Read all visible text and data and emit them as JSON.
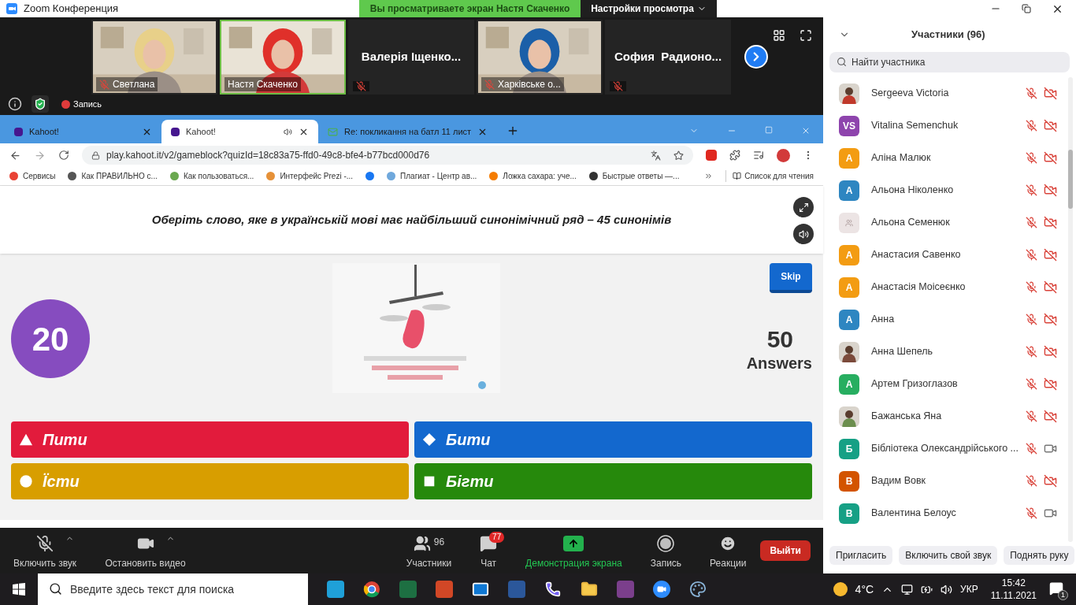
{
  "window": {
    "title": "Zoom Конференция"
  },
  "banner": {
    "text": "Вы просматриваете экран Настя Скаченко",
    "settings": "Настройки просмотра"
  },
  "videos": [
    {
      "kind": "video",
      "name": "Светлана",
      "muted": true,
      "selected": false
    },
    {
      "kind": "video",
      "name": "Настя Скаченко",
      "muted": false,
      "selected": true
    },
    {
      "kind": "name",
      "name": "Валерія Іщенко...",
      "muted": true,
      "selected": false
    },
    {
      "kind": "video",
      "name": "Харківське о...",
      "muted": true,
      "selected": false
    },
    {
      "kind": "name",
      "name": "София  Радионо...",
      "muted": true,
      "selected": false
    }
  ],
  "recording": "Запись",
  "browser": {
    "tabs": [
      {
        "title": "Kahoot!",
        "selected": false,
        "audio": false,
        "kind": "kahoot"
      },
      {
        "title": "Kahoot!",
        "selected": true,
        "audio": true,
        "kind": "kahoot"
      },
      {
        "title": "Re: покликання на батл 11 лист",
        "selected": false,
        "audio": false,
        "kind": "mail"
      }
    ],
    "url": "play.kahoot.it/v2/gameblock?quizId=18c83a75-ffd0-49c8-bfe4-b77bcd000d76",
    "bookmarks": [
      {
        "title": "Сервисы",
        "color": "#e94235"
      },
      {
        "title": "Как ПРАВИЛЬНО с...",
        "color": "#555555"
      },
      {
        "title": "Как пользоваться...",
        "color": "#6aa84f"
      },
      {
        "title": "Интерфейс Prezi -...",
        "color": "#e69138"
      },
      {
        "color": "#1877f2"
      },
      {
        "title": "Плагиат - Центр ав...",
        "color": "#6fa8dc"
      },
      {
        "title": "Ложка сахара: уче...",
        "color": "#f57c00"
      },
      {
        "title": "Быстрые ответы —...",
        "color": "#333333"
      }
    ],
    "reading_list": "Список для чтения"
  },
  "kahoot": {
    "question": "Оберіть слово, яке в українській мові має найбільший синонімічний ряд – 45 синонімів",
    "timer": "20",
    "skip": "Skip",
    "answers_count": "50",
    "answers_label": "Answers",
    "options": [
      {
        "kind": "triangle",
        "label": "Пити",
        "color": "#e21b3c"
      },
      {
        "kind": "diamond",
        "label": "Бити",
        "color": "#1368ce"
      },
      {
        "kind": "circle",
        "label": "Їсти",
        "color": "#d89e00"
      },
      {
        "kind": "square",
        "label": "Бігти",
        "color": "#26890c"
      }
    ]
  },
  "toolbar": {
    "items": [
      {
        "kind": "mic",
        "label": "Включить звук",
        "muted": true
      },
      {
        "kind": "video",
        "label": "Остановить видео"
      },
      {
        "kind": "participants",
        "label": "Участники",
        "count": "96"
      },
      {
        "kind": "chat",
        "label": "Чат",
        "badge": "77"
      },
      {
        "kind": "share",
        "label": "Демонстрация экрана",
        "active": true
      },
      {
        "kind": "record",
        "label": "Запись"
      },
      {
        "kind": "reactions",
        "label": "Реакции"
      }
    ],
    "leave": "Выйти"
  },
  "participants": {
    "title": "Участники (96)",
    "search_placeholder": "Найти участника",
    "people": [
      {
        "name": "Sergeeva Victoria",
        "mic_muted": true,
        "video_off": true,
        "color": "#c0392b"
      },
      {
        "name": "Vitalina Semenchuk",
        "kind": "initials",
        "initials": "VS",
        "color": "#8e44ad",
        "mic_muted": true,
        "video_off": true
      },
      {
        "name": "Аліна Малюк",
        "kind": "initials",
        "initials": "А",
        "color": "#f39c12",
        "mic_muted": true,
        "video_off": true
      },
      {
        "name": "Альона Ніколенко",
        "kind": "initials",
        "initials": "А",
        "color": "#2e86c1",
        "mic_muted": true,
        "video_off": true
      },
      {
        "name": "Альона Семенюк",
        "kind": "default",
        "color": "#ece4e4",
        "mic_muted": true,
        "video_off": true
      },
      {
        "name": "Анастасия Савенко",
        "kind": "initials",
        "initials": "А",
        "color": "#f39c12",
        "mic_muted": true,
        "video_off": true
      },
      {
        "name": "Анастасія Моісеєнко",
        "kind": "initials",
        "initials": "А",
        "color": "#f39c12",
        "mic_muted": true,
        "video_off": true
      },
      {
        "name": "Анна",
        "kind": "initials",
        "initials": "А",
        "color": "#2e86c1",
        "mic_muted": true,
        "video_off": true
      },
      {
        "name": "Анна Шепель",
        "color": "#7b4a3a",
        "mic_muted": true,
        "video_off": true
      },
      {
        "name": "Артем Гризоглазов",
        "kind": "initials",
        "initials": "А",
        "color": "#27ae60",
        "mic_muted": true,
        "video_off": true
      },
      {
        "name": "Бажанська Яна",
        "color": "#6b8e4e",
        "mic_muted": true,
        "video_off": true
      },
      {
        "name": "Бібліотека Олександрійського ...",
        "kind": "initials",
        "initials": "Б",
        "color": "#16a085",
        "mic_muted": true,
        "video_off": false
      },
      {
        "name": "Вадим Вовк",
        "kind": "initials",
        "initials": "В",
        "color": "#d35400",
        "mic_muted": true,
        "video_off": true
      },
      {
        "name": "Валентина Белоус",
        "kind": "initials",
        "initials": "В",
        "color": "#16a085",
        "mic_muted": true,
        "video_off": false
      }
    ],
    "buttons": [
      "Пригласить",
      "Включить свой звук",
      "Поднять руку"
    ]
  },
  "taskbar": {
    "search_placeholder": "Введите здесь текст для поиска",
    "weather": "4°C",
    "language": "УКР",
    "time": "15:42",
    "date": "11.11.2021",
    "notifications": "1"
  }
}
